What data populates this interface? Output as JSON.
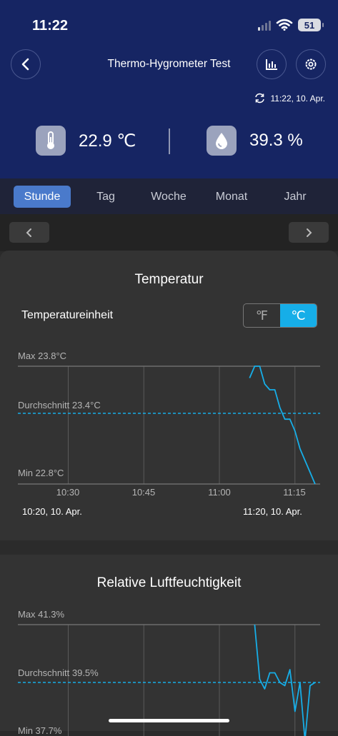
{
  "status_bar": {
    "time": "11:22",
    "battery": "51"
  },
  "header": {
    "title": "Thermo-Hygrometer Test",
    "sync_time": "11:22,  10. Apr.",
    "temperature": "22.9 ℃",
    "humidity": "39.3 %"
  },
  "tabs": [
    "Stunde",
    "Tag",
    "Woche",
    "Monat",
    "Jahr"
  ],
  "active_tab": "Stunde",
  "temp_card": {
    "title": "Temperatur",
    "unit_label": "Temperatureinheit",
    "unit_f": "℉",
    "unit_c": "℃",
    "selected_unit": "℃",
    "max_label": "Max 23.8°C",
    "avg_label": "Durchschnitt 23.4°C",
    "min_label": "Min 22.8°C",
    "x_ticks": [
      "10:30",
      "10:45",
      "11:00",
      "11:15"
    ],
    "range_start": "10:20,  10. Apr.",
    "range_end": "11:20,  10. Apr."
  },
  "humidity_card": {
    "title": "Relative Luftfeuchtigkeit",
    "max_label": "Max 41.3%",
    "avg_label": "Durchschnitt 39.5%",
    "min_label": "Min 37.7%"
  },
  "colors": {
    "header_bg": "#162563",
    "accent": "#16aee8",
    "active_tab": "#4a7acb"
  },
  "chart_data": [
    {
      "type": "line",
      "title": "Temperatur",
      "x_range": [
        "10:20",
        "11:20"
      ],
      "x_ticks": [
        "10:30",
        "10:45",
        "11:00",
        "11:15"
      ],
      "ylim": [
        22.8,
        23.8
      ],
      "avg": 23.4,
      "series": [
        {
          "x": [
            "11:06",
            "11:07",
            "11:08",
            "11:09",
            "11:10",
            "11:11",
            "11:12",
            "11:13",
            "11:14",
            "11:15",
            "11:16",
            "11:17",
            "11:18",
            "11:19"
          ],
          "y": [
            23.7,
            23.8,
            23.8,
            23.65,
            23.6,
            23.6,
            23.45,
            23.35,
            23.35,
            23.25,
            23.1,
            23.0,
            22.9,
            22.8
          ]
        }
      ]
    },
    {
      "type": "line",
      "title": "Relative Luftfeuchtigkeit",
      "x_range": [
        "10:20",
        "11:20"
      ],
      "ylim": [
        37.7,
        41.3
      ],
      "avg": 39.5,
      "series": [
        {
          "x": [
            "11:07",
            "11:08",
            "11:09",
            "11:10",
            "11:11",
            "11:12",
            "11:13",
            "11:14",
            "11:15",
            "11:16",
            "11:17",
            "11:18",
            "11:19"
          ],
          "y": [
            41.3,
            39.6,
            39.3,
            39.8,
            39.8,
            39.5,
            39.4,
            39.9,
            38.6,
            39.5,
            37.7,
            39.4,
            39.5
          ]
        }
      ]
    }
  ]
}
